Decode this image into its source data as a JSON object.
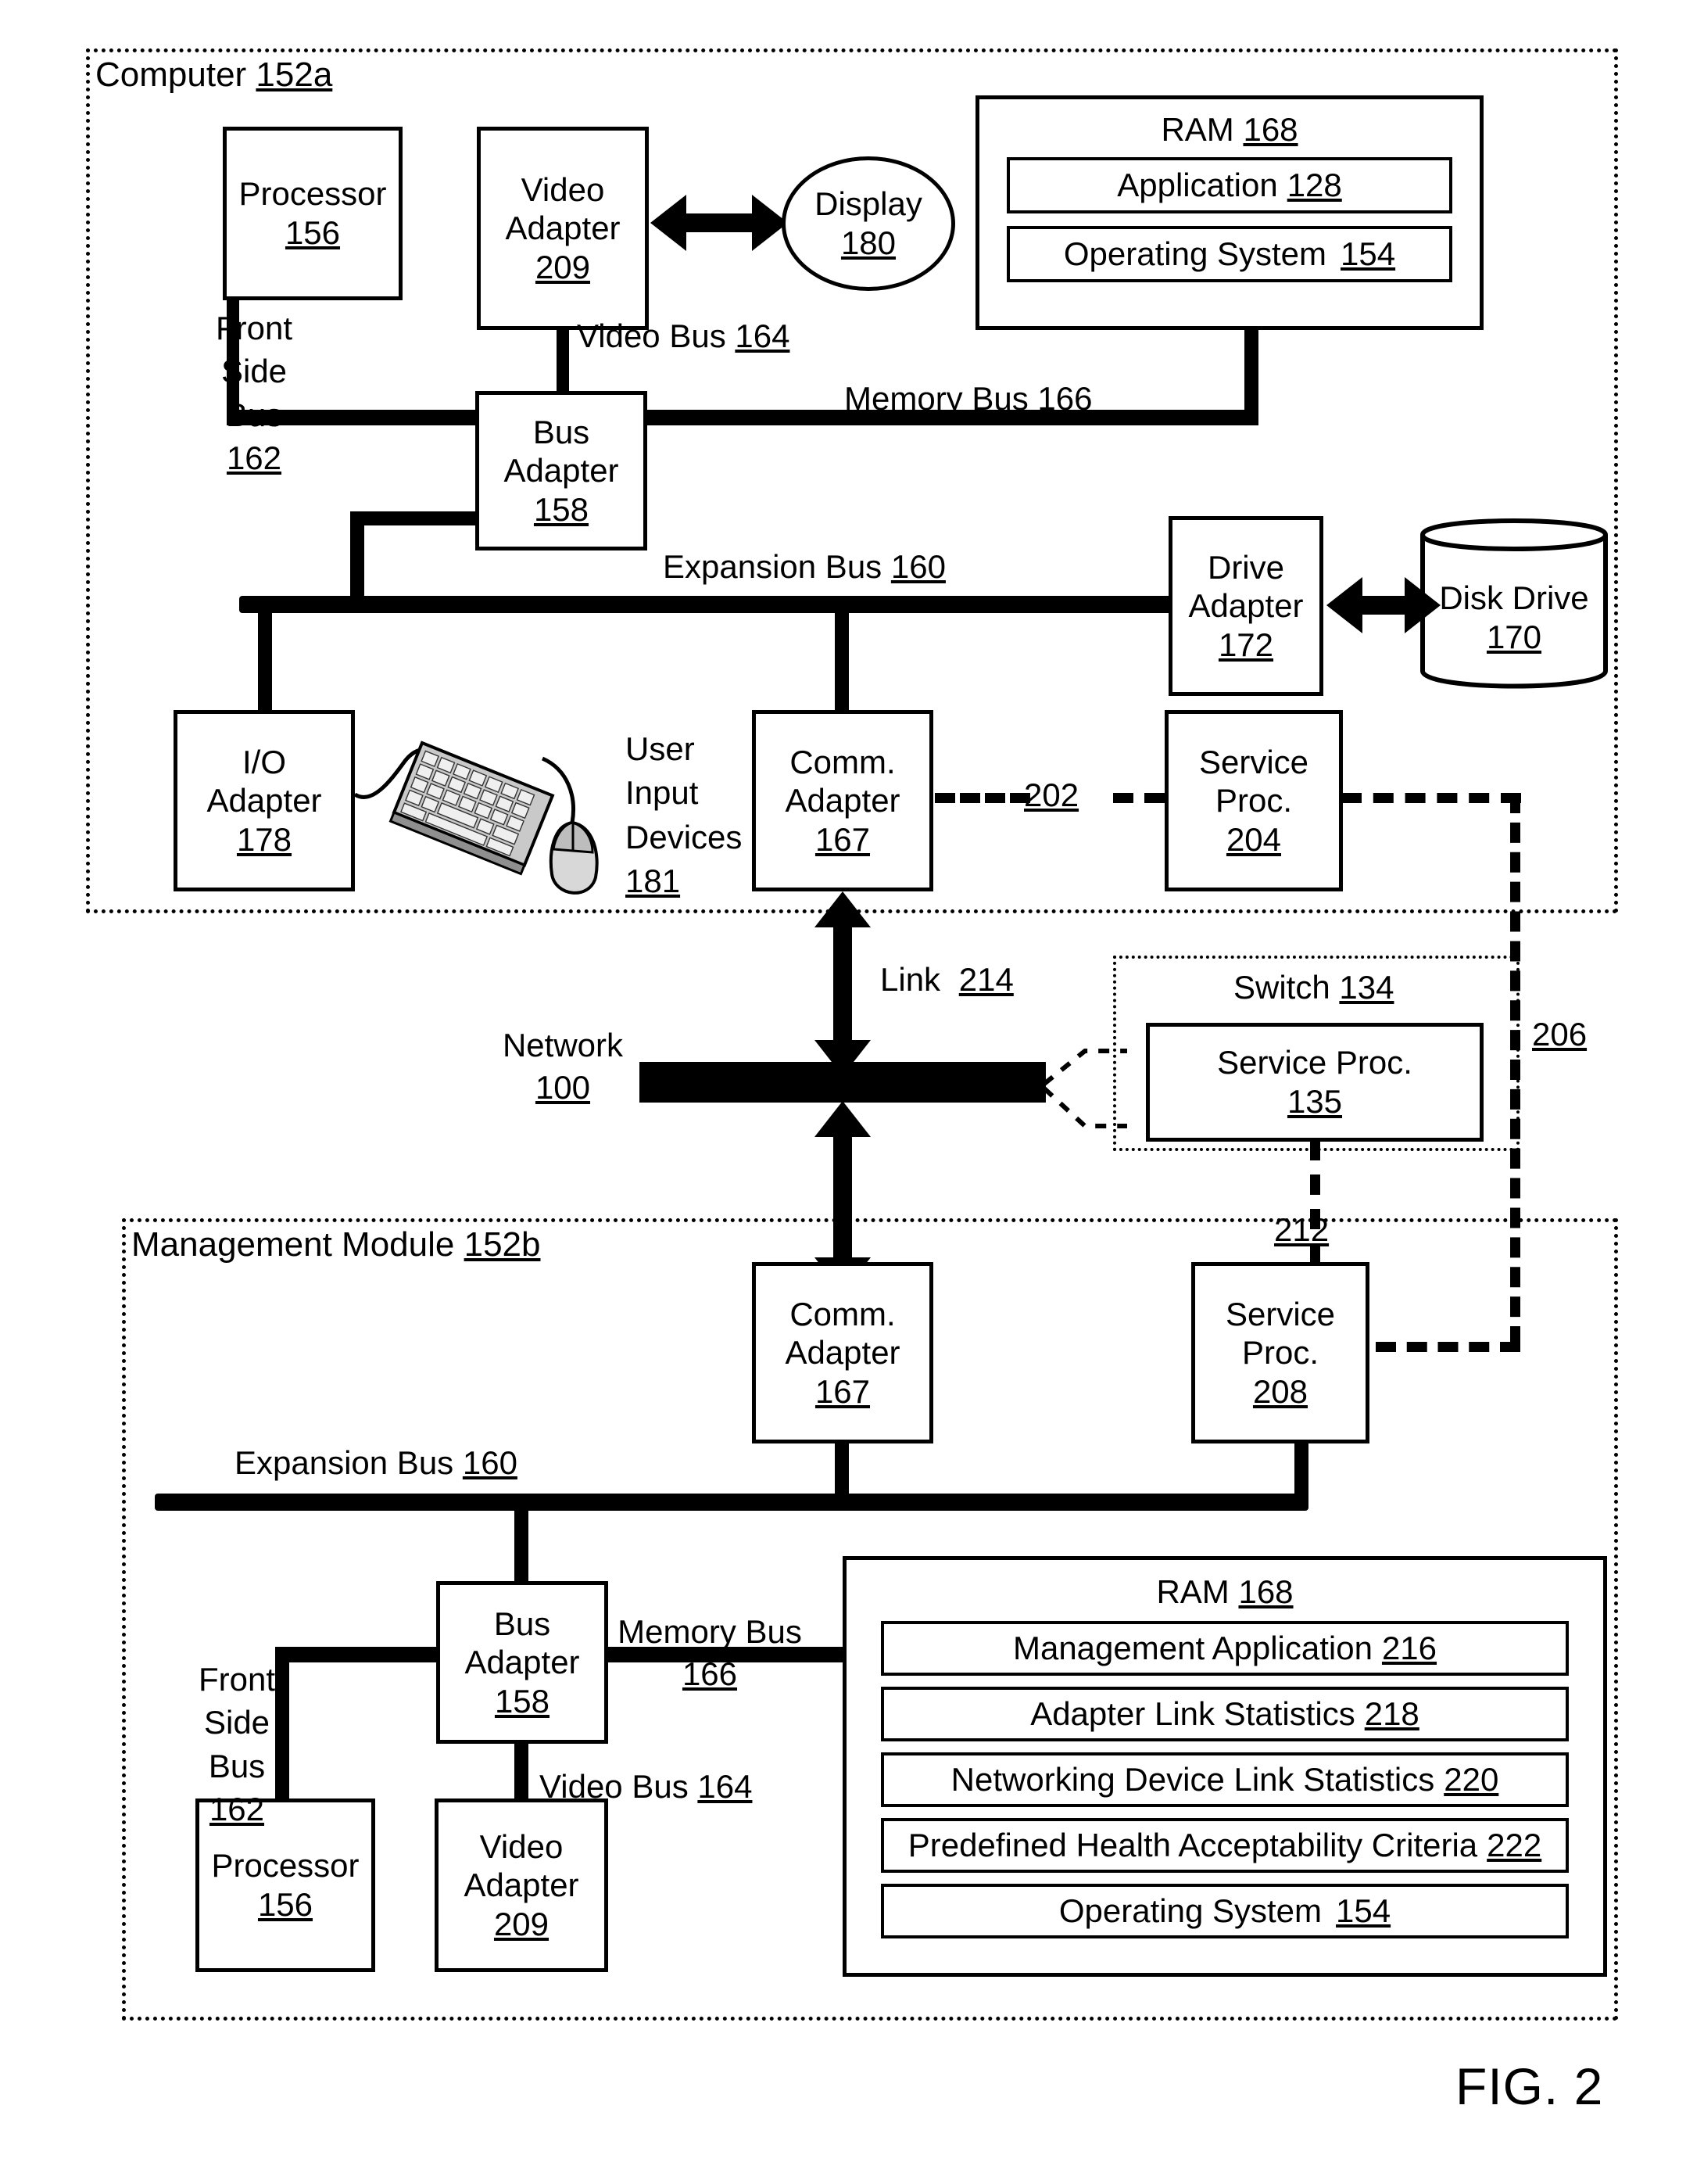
{
  "figure": {
    "caption": "FIG. 2"
  },
  "computer": {
    "title": "Computer",
    "ref": "152a",
    "processor": {
      "line1": "Processor",
      "ref": "156"
    },
    "video_adapter": {
      "line1": "Video",
      "line2": "Adapter",
      "ref": "209"
    },
    "display": {
      "line1": "Display",
      "ref": "180"
    },
    "ram": {
      "title": "RAM",
      "ref": "168",
      "items": [
        {
          "label": "Application",
          "ref": "128"
        },
        {
          "label": "Operating System",
          "ref": "154"
        }
      ]
    },
    "bus_adapter": {
      "line1": "Bus",
      "line2": "Adapter",
      "ref": "158"
    },
    "front_side_bus": {
      "line1": "Front",
      "line2": "Side",
      "line3": "Bus",
      "ref": "162"
    },
    "video_bus": {
      "label": "Video Bus",
      "ref": "164"
    },
    "memory_bus": {
      "label": "Memory Bus",
      "ref": "166"
    },
    "expansion_bus": {
      "label": "Expansion Bus",
      "ref": "160"
    },
    "drive_adapter": {
      "line1": "Drive",
      "line2": "Adapter",
      "ref": "172"
    },
    "disk_drive": {
      "line1": "Disk Drive",
      "ref": "170"
    },
    "io_adapter": {
      "line1": "I/O",
      "line2": "Adapter",
      "ref": "178"
    },
    "user_input_devices": {
      "line1": "User",
      "line2": "Input",
      "line3": "Devices",
      "ref": "181"
    },
    "comm_adapter": {
      "line1": "Comm.",
      "line2": "Adapter",
      "ref": "167"
    },
    "service_proc": {
      "line1": "Service",
      "line2": "Proc.",
      "ref": "204"
    },
    "link_202": {
      "ref": "202"
    }
  },
  "network": {
    "label": "Network",
    "ref": "100",
    "link": {
      "label": "Link",
      "ref": "214"
    }
  },
  "switch": {
    "title": "Switch",
    "ref": "134",
    "service_proc": {
      "line1": "Service Proc.",
      "ref": "135"
    }
  },
  "links": {
    "link_206": {
      "ref": "206"
    },
    "link_212": {
      "ref": "212"
    }
  },
  "management_module": {
    "title": "Management Module",
    "ref": "152b",
    "comm_adapter": {
      "line1": "Comm.",
      "line2": "Adapter",
      "ref": "167"
    },
    "service_proc": {
      "line1": "Service",
      "line2": "Proc.",
      "ref": "208"
    },
    "expansion_bus": {
      "label": "Expansion Bus",
      "ref": "160"
    },
    "bus_adapter": {
      "line1": "Bus",
      "line2": "Adapter",
      "ref": "158"
    },
    "front_side_bus": {
      "line1": "Front",
      "line2": "Side",
      "line3": "Bus",
      "ref": "162"
    },
    "memory_bus": {
      "line1": "Memory Bus",
      "ref": "166"
    },
    "video_bus": {
      "label": "Video Bus",
      "ref": "164"
    },
    "processor": {
      "line1": "Processor",
      "ref": "156"
    },
    "video_adapter": {
      "line1": "Video",
      "line2": "Adapter",
      "ref": "209"
    },
    "ram": {
      "title": "RAM",
      "ref": "168",
      "items": [
        {
          "label": "Management Application",
          "ref": "216"
        },
        {
          "label": "Adapter Link Statistics",
          "ref": "218"
        },
        {
          "label": "Networking Device Link Statistics",
          "ref": "220"
        },
        {
          "label": "Predefined Health Acceptability Criteria",
          "ref": "222"
        },
        {
          "label": "Operating System",
          "ref": "154"
        }
      ]
    }
  },
  "colors": {
    "ink": "#000000",
    "paper": "#ffffff"
  }
}
